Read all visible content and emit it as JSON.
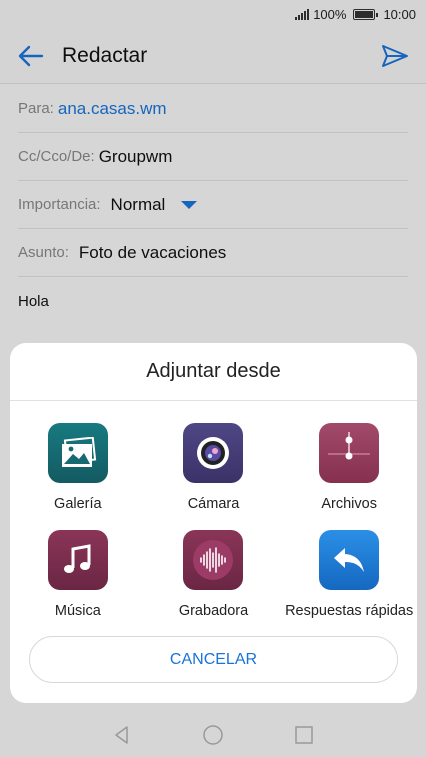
{
  "status": {
    "battery_percent": "100%",
    "time": "10:00"
  },
  "toolbar": {
    "title": "Redactar"
  },
  "form": {
    "to_label": "Para:",
    "to_value": "ana.casas.wm",
    "cc_label": "Cc/Cco/De:",
    "cc_value": "Groupwm",
    "importance_label": "Importancia:",
    "importance_value": "Normal",
    "subject_label": "Asunto:",
    "subject_value": "Foto de vacaciones",
    "body": "Hola"
  },
  "sheet": {
    "title": "Adjuntar desde",
    "apps": [
      {
        "label": "Galería",
        "icon": "gallery-icon",
        "color": "#1b6a72"
      },
      {
        "label": "Cámara",
        "icon": "camera-icon",
        "color": "#4a3f7a"
      },
      {
        "label": "Archivos",
        "icon": "files-icon",
        "color": "#9b3a5c"
      },
      {
        "label": "Música",
        "icon": "music-icon",
        "color": "#7a2f4e"
      },
      {
        "label": "Grabadora",
        "icon": "recorder-icon",
        "color": "#7a2f4e"
      },
      {
        "label": "Respuestas rápidas",
        "icon": "quick-reply-icon",
        "color": "#1f7fd6"
      }
    ],
    "cancel_label": "CANCELAR"
  },
  "accent_color": "#1a73d9"
}
